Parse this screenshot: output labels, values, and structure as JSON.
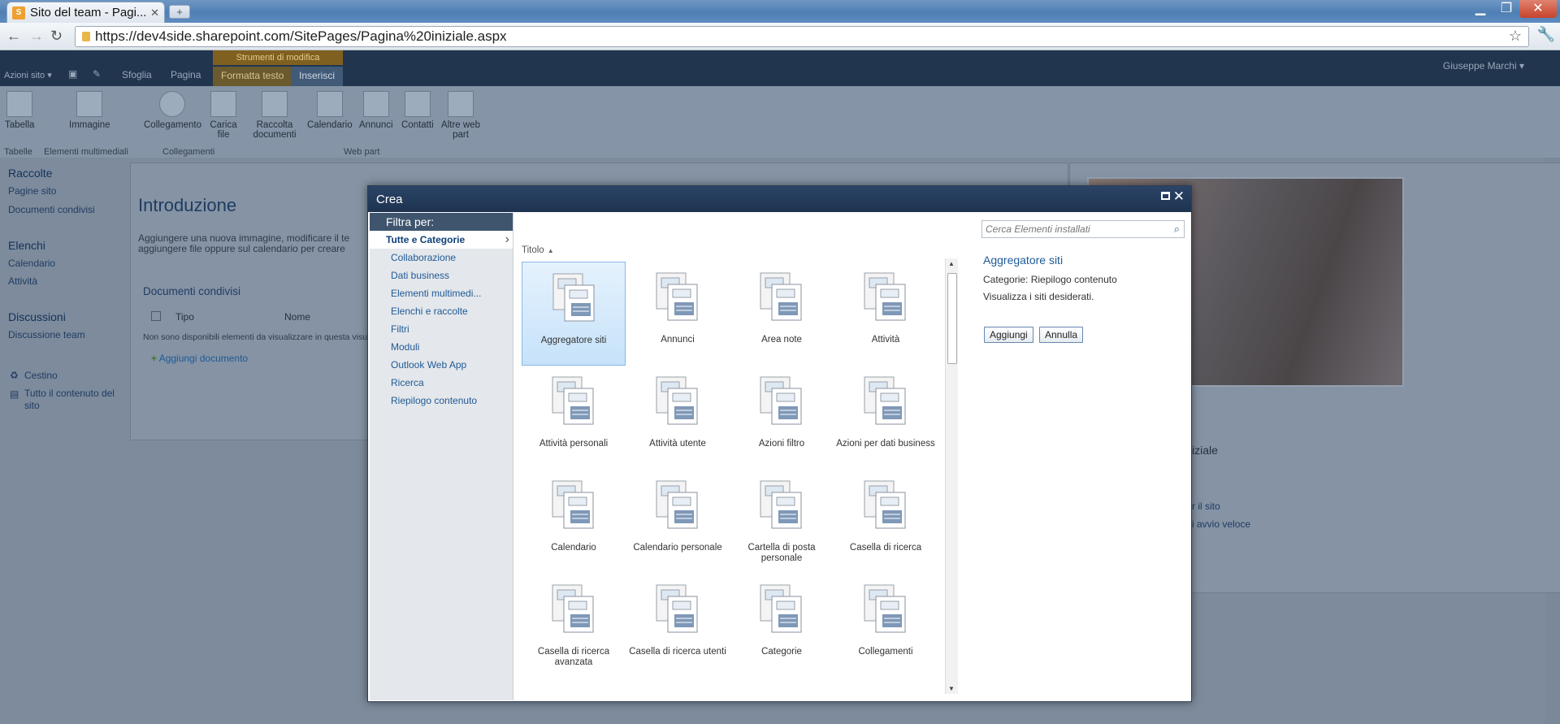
{
  "browser": {
    "tab_title": "Sito del team - Pagi...",
    "url": "https://dev4side.sharepoint.com/SitePages/Pagina%20iniziale.aspx"
  },
  "sp": {
    "site_actions": "Azioni sito",
    "context_group": "Strumenti di modifica",
    "tabs": [
      "Sfoglia",
      "Pagina",
      "Formatta testo",
      "Inserisci"
    ],
    "user": "Giuseppe Marchi",
    "ribbon": {
      "items": [
        "Tabella",
        "Immagine",
        "Collegamento",
        "Carica file",
        "Raccolta documenti",
        "Calendario",
        "Annunci",
        "Contatti",
        "Altre web part"
      ],
      "groups": [
        "Tabelle",
        "Elementi multimediali",
        "Collegamenti",
        "Web part"
      ]
    },
    "left_nav": {
      "raccolte": "Raccolte",
      "pagine_sito": "Pagine sito",
      "documenti_condivisi": "Documenti condivisi",
      "elenchi": "Elenchi",
      "calendario": "Calendario",
      "attivita": "Attività",
      "discussioni": "Discussioni",
      "discussione_team": "Discussione team",
      "cestino": "Cestino",
      "tutto_contenuto": "Tutto il contenuto del sito"
    },
    "content": {
      "heading": "Introduzione",
      "text1": "Aggiungere una nuova immagine, modificare il te",
      "text2": "aggiungere file oppure sul calendario per creare",
      "docs_title": "Documenti condivisi",
      "col_tipo": "Tipo",
      "col_nome": "Nome",
      "empty": "Non sono disponibili elementi da visualizzare in questa visu",
      "add_doc": "Aggiungi documento"
    },
    "right_fragments": [
      "iziale",
      "r il sito",
      "i avvio veloce"
    ]
  },
  "dialog": {
    "title": "Crea",
    "filter_header": "Filtra per:",
    "filters": [
      "Tutte e Categorie",
      "Collaborazione",
      "Dati business",
      "Elementi multimedi...",
      "Elenchi e raccolte",
      "Filtri",
      "Moduli",
      "Outlook Web App",
      "Ricerca",
      "Riepilogo contenuto"
    ],
    "sort_label": "Titolo",
    "search_placeholder": "Cerca Elementi installati",
    "tiles": [
      "Aggregatore siti",
      "Annunci",
      "Area note",
      "Attività",
      "Attività personali",
      "Attività utente",
      "Azioni filtro",
      "Azioni per dati business",
      "Calendario",
      "Calendario personale",
      "Cartella di posta personale",
      "Casella di ricerca",
      "Casella di ricerca avanzata",
      "Casella di ricerca utenti",
      "Categorie",
      "Collegamenti"
    ],
    "detail": {
      "title": "Aggregatore siti",
      "category": "Categorie: Riepilogo contenuto",
      "description": "Visualizza i siti desiderati."
    },
    "add_button": "Aggiungi",
    "cancel_button": "Annulla"
  },
  "colors": {
    "dialog_header": "#1d3350",
    "link": "#1f5a96",
    "selected_tile": "#c6e2fa"
  }
}
